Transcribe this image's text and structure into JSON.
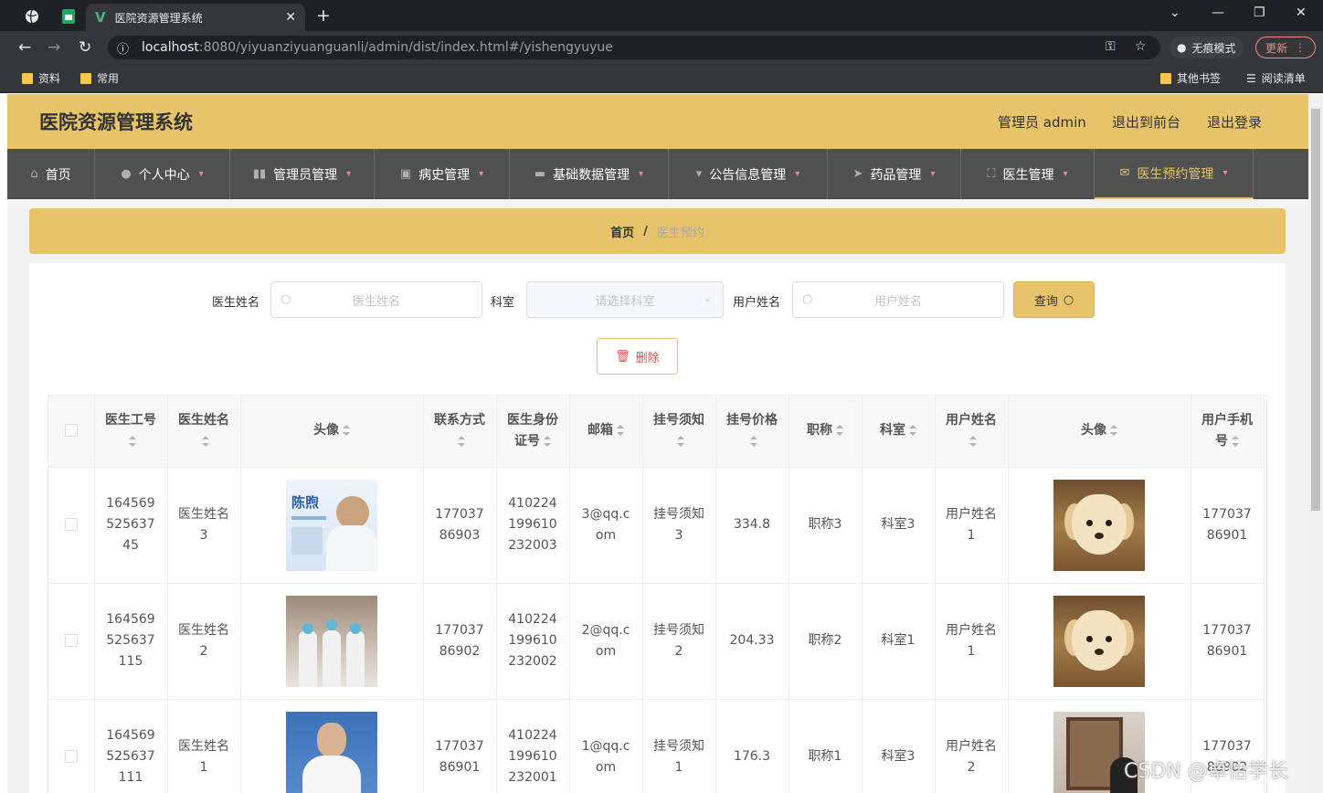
{
  "browser": {
    "tab_title": "医院资源管理系统",
    "url_host": "localhost",
    "url_rest": ":8080/yiyuanziyuanguanli/admin/dist/index.html#/yishengyuyue",
    "incognito_label": "无痕模式",
    "update_label": "更新",
    "bookmarks": [
      "资料",
      "常用"
    ],
    "bookmarks_right": [
      "其他书签",
      "阅读清单"
    ]
  },
  "header": {
    "title": "医院资源管理系统",
    "user": "管理员 admin",
    "to_front": "退出到前台",
    "logout": "退出登录"
  },
  "menu": [
    {
      "label": "首页",
      "icon": "home-icon"
    },
    {
      "label": "个人中心",
      "icon": "user-icon"
    },
    {
      "label": "管理员管理",
      "icon": "book-icon"
    },
    {
      "label": "病史管理",
      "icon": "clipboard-icon"
    },
    {
      "label": "基础数据管理",
      "icon": "monitor-icon"
    },
    {
      "label": "公告信息管理",
      "icon": "brush-icon"
    },
    {
      "label": "药品管理",
      "icon": "send-icon"
    },
    {
      "label": "医生管理",
      "icon": "fullscreen-icon"
    },
    {
      "label": "医生预约管理",
      "icon": "mail-icon"
    }
  ],
  "breadcrumb": {
    "home": "首页",
    "sep": "/",
    "current": "医生预约"
  },
  "search": {
    "doctor_name_label": "医生姓名",
    "doctor_name_placeholder": "医生姓名",
    "dept_label": "科室",
    "dept_placeholder": "请选择科室",
    "user_name_label": "用户姓名",
    "user_name_placeholder": "用户姓名",
    "query_label": "查询"
  },
  "delete_label": "删除",
  "table": {
    "headers": [
      "医生工号",
      "医生姓名",
      "头像",
      "联系方式",
      "医生身份证号",
      "邮箱",
      "挂号须知",
      "挂号价格",
      "职称",
      "科室",
      "用户姓名",
      "头像",
      "用户手机号"
    ],
    "rows": [
      {
        "doc_no": "16456952563745",
        "doc_name": "医生姓名3",
        "phone": "17703786903",
        "id_card": "410224199610232003",
        "email": "3@qq.com",
        "notice": "挂号须知3",
        "price": "334.8",
        "title": "职称3",
        "dept": "科室3",
        "user_name": "用户姓名1",
        "user_phone": "17703786901"
      },
      {
        "doc_no": "164569525637115",
        "doc_name": "医生姓名2",
        "phone": "17703786902",
        "id_card": "410224199610232002",
        "email": "2@qq.com",
        "notice": "挂号须知2",
        "price": "204.33",
        "title": "职称2",
        "dept": "科室1",
        "user_name": "用户姓名1",
        "user_phone": "17703786901"
      },
      {
        "doc_no": "164569525637111",
        "doc_name": "医生姓名1",
        "phone": "17703786901",
        "id_card": "410224199610232001",
        "email": "1@qq.com",
        "notice": "挂号须知1",
        "price": "176.3",
        "title": "职称1",
        "dept": "科室3",
        "user_name": "用户姓名2",
        "user_phone": "17703786902"
      }
    ]
  },
  "photo_text": "陈煦",
  "watermark": "CSDN @卓怡学长"
}
